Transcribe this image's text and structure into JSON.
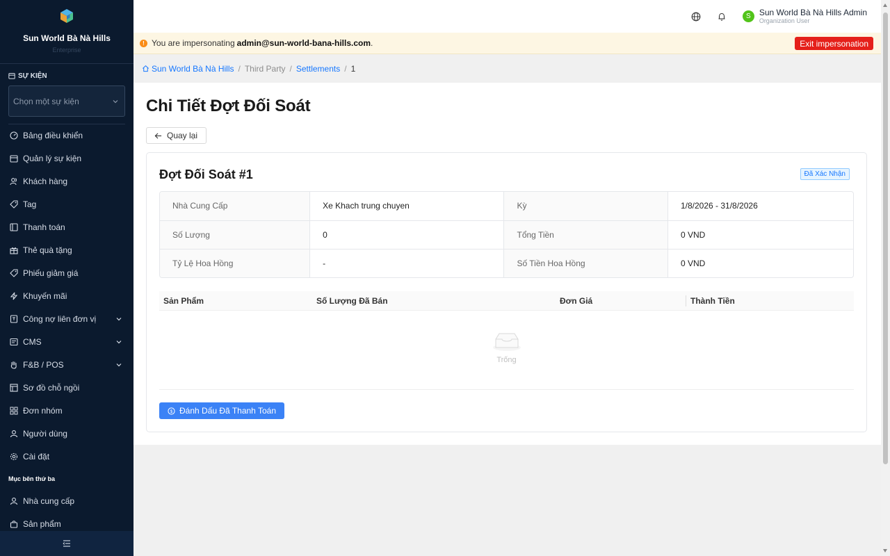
{
  "brand": {
    "name": "Sun World Bà Nà Hills",
    "sub": "Enterprise"
  },
  "event": {
    "heading": "SỰ KIỆN",
    "placeholder": "Chọn một sự kiện"
  },
  "menu": [
    {
      "label": "Bảng điều khiển",
      "icon": "dashboard-icon"
    },
    {
      "label": "Quản lý sự kiện",
      "icon": "calendar-icon"
    },
    {
      "label": "Khách hàng",
      "icon": "customers-icon"
    },
    {
      "label": "Tag",
      "icon": "tag-icon"
    },
    {
      "label": "Thanh toán",
      "icon": "payment-icon"
    },
    {
      "label": "Thẻ quà tặng",
      "icon": "gift-icon"
    },
    {
      "label": "Phiếu giảm giá",
      "icon": "coupon-icon"
    },
    {
      "label": "Khuyến mãi",
      "icon": "lightning-icon"
    },
    {
      "label": "Công nợ liên đơn vị",
      "icon": "ledger-icon",
      "expandable": true
    },
    {
      "label": "CMS",
      "icon": "document-icon",
      "expandable": true
    },
    {
      "label": "F&B / POS",
      "icon": "hand-icon",
      "expandable": true
    },
    {
      "label": "Sơ đồ chỗ ngồi",
      "icon": "seat-map-icon"
    },
    {
      "label": "Đơn nhóm",
      "icon": "grid-icon"
    },
    {
      "label": "Người dùng",
      "icon": "user-icon"
    },
    {
      "label": "Cài đặt",
      "icon": "settings-icon"
    }
  ],
  "third_party": {
    "heading": "Mục bên thứ ba",
    "items": [
      {
        "label": "Nhà cung cấp",
        "icon": "user-icon"
      },
      {
        "label": "Sản phẩm",
        "icon": "bag-icon"
      }
    ]
  },
  "header": {
    "user_name": "Sun World Bà Nà Hills Admin",
    "user_role": "Organization User",
    "avatar_letter": "S"
  },
  "banner": {
    "prefix": "You are impersonating",
    "email": "admin@sun-world-bana-hills.com",
    "suffix": ".",
    "exit_label": "Exit impersonation"
  },
  "breadcrumb": {
    "home": "Sun World Bà Nà Hills",
    "section": "Third Party",
    "list": "Settlements",
    "current": "1"
  },
  "page": {
    "title": "Chi Tiết Đợt Đối Soát",
    "back_label": "Quay lại",
    "card_title": "Đợt Đối Soát #1",
    "status": "Đã Xác Nhận",
    "details": [
      [
        {
          "label": "Nhà Cung Cấp",
          "value": "Xe Khach trung chuyen"
        },
        {
          "label": "Kỳ",
          "value": "1/8/2026 - 31/8/2026"
        }
      ],
      [
        {
          "label": "Số Lượng",
          "value": "0"
        },
        {
          "label": "Tổng Tiền",
          "value": "0 VND"
        }
      ],
      [
        {
          "label": "Tỷ Lệ Hoa Hồng",
          "value": "-"
        },
        {
          "label": "Số Tiền Hoa Hồng",
          "value": "0 VND"
        }
      ]
    ],
    "table": {
      "columns": [
        "Sản Phẩm",
        "Số Lượng Đã Bán",
        "Đơn Giá",
        "Thành Tiền"
      ],
      "empty": "Trống"
    },
    "mark_paid_label": "Đánh Dấu Đã Thanh Toán"
  },
  "colors": {
    "sidebar": "#0b1a2e",
    "primary": "#3b82f6",
    "danger": "#e5201a",
    "banner": "#fdf6e3"
  }
}
